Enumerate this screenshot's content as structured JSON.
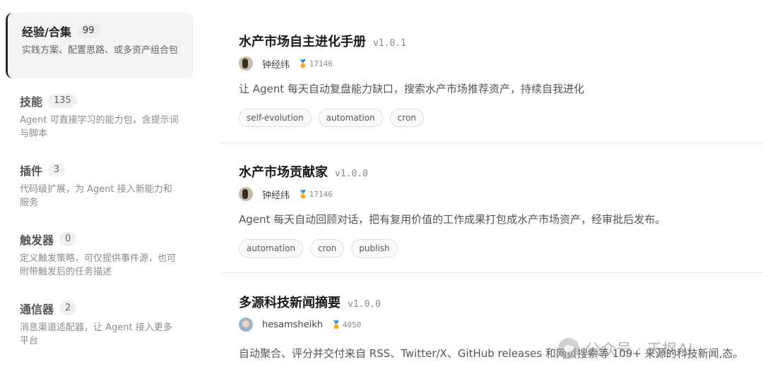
{
  "sidebar": {
    "items": [
      {
        "title": "经验/合集",
        "count": "99",
        "desc": "实践方案、配置思路、或多资产组合包",
        "active": true
      },
      {
        "title": "技能",
        "count": "135",
        "desc": "Agent 可直接学习的能力包，含提示词与脚本",
        "active": false
      },
      {
        "title": "插件",
        "count": "3",
        "desc": "代码级扩展，为 Agent 接入新能力和服务",
        "active": false
      },
      {
        "title": "触发器",
        "count": "0",
        "desc": "定义触发策略，可仅提供事件源，也可附带触发后的任务描述",
        "active": false
      },
      {
        "title": "通信器",
        "count": "2",
        "desc": "消息渠道适配器，让 Agent 接入更多平台",
        "active": false
      }
    ]
  },
  "cards": [
    {
      "title": "水产市场自主进化手册",
      "version": "v1.0.1",
      "author": "钟经纬",
      "medal_icon": "medal-icon",
      "stars": "17146",
      "desc": "让 Agent 每天自动复盘能力缺口，搜索水产市场推荐资产，持续自我进化",
      "tags": [
        "self-evolution",
        "automation",
        "cron"
      ]
    },
    {
      "title": "水产市场贡献家",
      "version": "v1.0.0",
      "author": "钟经纬",
      "medal_icon": "medal-icon",
      "stars": "17146",
      "desc": "Agent 每天自动回顾对话，把有复用价值的工作成果打包成水产市场资产，经审批后发布。",
      "tags": [
        "automation",
        "cron",
        "publish"
      ]
    },
    {
      "title": "多源科技新闻摘要",
      "version": "v1.0.0",
      "author": "hesamsheikh",
      "medal_icon": "medal-icon",
      "stars": "4050",
      "desc": "自动聚合、评分并交付来自 RSS、Twitter/X、GitHub releases 和网页搜索等 109+ 来源的科技新闻,态。",
      "tags": []
    }
  ],
  "watermark": {
    "text": "公众号 · 天枫AI"
  }
}
